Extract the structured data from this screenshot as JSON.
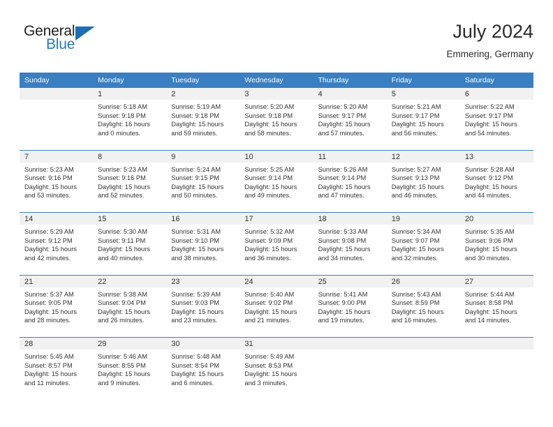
{
  "brand": {
    "name_part1": "General",
    "name_part2": "Blue",
    "logo_icon": "triangle-flag-icon"
  },
  "header": {
    "title": "July 2024",
    "location": "Emmering, Germany"
  },
  "calendar": {
    "weekday_headers": [
      "Sunday",
      "Monday",
      "Tuesday",
      "Wednesday",
      "Thursday",
      "Friday",
      "Saturday"
    ],
    "accent_color": "#3a7fc1",
    "daynum_bg": "#f1f1f1",
    "weeks": [
      {
        "days": [
          {
            "num": "",
            "sunrise": "",
            "sunset": "",
            "daylight1": "",
            "daylight2": ""
          },
          {
            "num": "1",
            "sunrise": "Sunrise: 5:18 AM",
            "sunset": "Sunset: 9:18 PM",
            "daylight1": "Daylight: 16 hours",
            "daylight2": "and 0 minutes."
          },
          {
            "num": "2",
            "sunrise": "Sunrise: 5:19 AM",
            "sunset": "Sunset: 9:18 PM",
            "daylight1": "Daylight: 15 hours",
            "daylight2": "and 59 minutes."
          },
          {
            "num": "3",
            "sunrise": "Sunrise: 5:20 AM",
            "sunset": "Sunset: 9:18 PM",
            "daylight1": "Daylight: 15 hours",
            "daylight2": "and 58 minutes."
          },
          {
            "num": "4",
            "sunrise": "Sunrise: 5:20 AM",
            "sunset": "Sunset: 9:17 PM",
            "daylight1": "Daylight: 15 hours",
            "daylight2": "and 57 minutes."
          },
          {
            "num": "5",
            "sunrise": "Sunrise: 5:21 AM",
            "sunset": "Sunset: 9:17 PM",
            "daylight1": "Daylight: 15 hours",
            "daylight2": "and 56 minutes."
          },
          {
            "num": "6",
            "sunrise": "Sunrise: 5:22 AM",
            "sunset": "Sunset: 9:17 PM",
            "daylight1": "Daylight: 15 hours",
            "daylight2": "and 54 minutes."
          }
        ]
      },
      {
        "days": [
          {
            "num": "7",
            "sunrise": "Sunrise: 5:23 AM",
            "sunset": "Sunset: 9:16 PM",
            "daylight1": "Daylight: 15 hours",
            "daylight2": "and 53 minutes."
          },
          {
            "num": "8",
            "sunrise": "Sunrise: 5:23 AM",
            "sunset": "Sunset: 9:16 PM",
            "daylight1": "Daylight: 15 hours",
            "daylight2": "and 52 minutes."
          },
          {
            "num": "9",
            "sunrise": "Sunrise: 5:24 AM",
            "sunset": "Sunset: 9:15 PM",
            "daylight1": "Daylight: 15 hours",
            "daylight2": "and 50 minutes."
          },
          {
            "num": "10",
            "sunrise": "Sunrise: 5:25 AM",
            "sunset": "Sunset: 9:14 PM",
            "daylight1": "Daylight: 15 hours",
            "daylight2": "and 49 minutes."
          },
          {
            "num": "11",
            "sunrise": "Sunrise: 5:26 AM",
            "sunset": "Sunset: 9:14 PM",
            "daylight1": "Daylight: 15 hours",
            "daylight2": "and 47 minutes."
          },
          {
            "num": "12",
            "sunrise": "Sunrise: 5:27 AM",
            "sunset": "Sunset: 9:13 PM",
            "daylight1": "Daylight: 15 hours",
            "daylight2": "and 46 minutes."
          },
          {
            "num": "13",
            "sunrise": "Sunrise: 5:28 AM",
            "sunset": "Sunset: 9:12 PM",
            "daylight1": "Daylight: 15 hours",
            "daylight2": "and 44 minutes."
          }
        ]
      },
      {
        "days": [
          {
            "num": "14",
            "sunrise": "Sunrise: 5:29 AM",
            "sunset": "Sunset: 9:12 PM",
            "daylight1": "Daylight: 15 hours",
            "daylight2": "and 42 minutes."
          },
          {
            "num": "15",
            "sunrise": "Sunrise: 5:30 AM",
            "sunset": "Sunset: 9:11 PM",
            "daylight1": "Daylight: 15 hours",
            "daylight2": "and 40 minutes."
          },
          {
            "num": "16",
            "sunrise": "Sunrise: 5:31 AM",
            "sunset": "Sunset: 9:10 PM",
            "daylight1": "Daylight: 15 hours",
            "daylight2": "and 38 minutes."
          },
          {
            "num": "17",
            "sunrise": "Sunrise: 5:32 AM",
            "sunset": "Sunset: 9:09 PM",
            "daylight1": "Daylight: 15 hours",
            "daylight2": "and 36 minutes."
          },
          {
            "num": "18",
            "sunrise": "Sunrise: 5:33 AM",
            "sunset": "Sunset: 9:08 PM",
            "daylight1": "Daylight: 15 hours",
            "daylight2": "and 34 minutes."
          },
          {
            "num": "19",
            "sunrise": "Sunrise: 5:34 AM",
            "sunset": "Sunset: 9:07 PM",
            "daylight1": "Daylight: 15 hours",
            "daylight2": "and 32 minutes."
          },
          {
            "num": "20",
            "sunrise": "Sunrise: 5:35 AM",
            "sunset": "Sunset: 9:06 PM",
            "daylight1": "Daylight: 15 hours",
            "daylight2": "and 30 minutes."
          }
        ]
      },
      {
        "days": [
          {
            "num": "21",
            "sunrise": "Sunrise: 5:37 AM",
            "sunset": "Sunset: 9:05 PM",
            "daylight1": "Daylight: 15 hours",
            "daylight2": "and 28 minutes."
          },
          {
            "num": "22",
            "sunrise": "Sunrise: 5:38 AM",
            "sunset": "Sunset: 9:04 PM",
            "daylight1": "Daylight: 15 hours",
            "daylight2": "and 26 minutes."
          },
          {
            "num": "23",
            "sunrise": "Sunrise: 5:39 AM",
            "sunset": "Sunset: 9:03 PM",
            "daylight1": "Daylight: 15 hours",
            "daylight2": "and 23 minutes."
          },
          {
            "num": "24",
            "sunrise": "Sunrise: 5:40 AM",
            "sunset": "Sunset: 9:02 PM",
            "daylight1": "Daylight: 15 hours",
            "daylight2": "and 21 minutes."
          },
          {
            "num": "25",
            "sunrise": "Sunrise: 5:41 AM",
            "sunset": "Sunset: 9:00 PM",
            "daylight1": "Daylight: 15 hours",
            "daylight2": "and 19 minutes."
          },
          {
            "num": "26",
            "sunrise": "Sunrise: 5:43 AM",
            "sunset": "Sunset: 8:59 PM",
            "daylight1": "Daylight: 15 hours",
            "daylight2": "and 16 minutes."
          },
          {
            "num": "27",
            "sunrise": "Sunrise: 5:44 AM",
            "sunset": "Sunset: 8:58 PM",
            "daylight1": "Daylight: 15 hours",
            "daylight2": "and 14 minutes."
          }
        ]
      },
      {
        "days": [
          {
            "num": "28",
            "sunrise": "Sunrise: 5:45 AM",
            "sunset": "Sunset: 8:57 PM",
            "daylight1": "Daylight: 15 hours",
            "daylight2": "and 11 minutes."
          },
          {
            "num": "29",
            "sunrise": "Sunrise: 5:46 AM",
            "sunset": "Sunset: 8:55 PM",
            "daylight1": "Daylight: 15 hours",
            "daylight2": "and 9 minutes."
          },
          {
            "num": "30",
            "sunrise": "Sunrise: 5:48 AM",
            "sunset": "Sunset: 8:54 PM",
            "daylight1": "Daylight: 15 hours",
            "daylight2": "and 6 minutes."
          },
          {
            "num": "31",
            "sunrise": "Sunrise: 5:49 AM",
            "sunset": "Sunset: 8:53 PM",
            "daylight1": "Daylight: 15 hours",
            "daylight2": "and 3 minutes."
          },
          {
            "num": "",
            "sunrise": "",
            "sunset": "",
            "daylight1": "",
            "daylight2": ""
          },
          {
            "num": "",
            "sunrise": "",
            "sunset": "",
            "daylight1": "",
            "daylight2": ""
          },
          {
            "num": "",
            "sunrise": "",
            "sunset": "",
            "daylight1": "",
            "daylight2": ""
          }
        ]
      }
    ]
  }
}
